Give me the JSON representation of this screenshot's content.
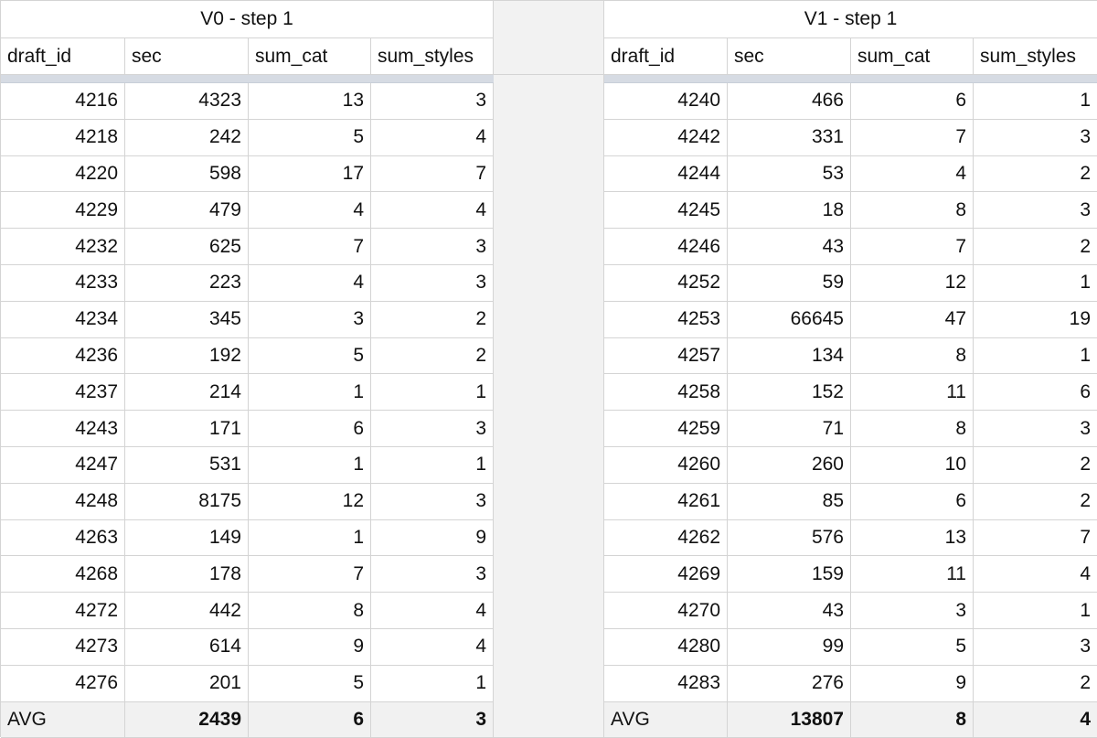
{
  "v0": {
    "title": "V0 - step 1",
    "headers": [
      "draft_id",
      "sec",
      "sum_cat",
      "sum_styles"
    ],
    "rows": [
      [
        "4216",
        "4323",
        "13",
        "3"
      ],
      [
        "4218",
        "242",
        "5",
        "4"
      ],
      [
        "4220",
        "598",
        "17",
        "7"
      ],
      [
        "4229",
        "479",
        "4",
        "4"
      ],
      [
        "4232",
        "625",
        "7",
        "3"
      ],
      [
        "4233",
        "223",
        "4",
        "3"
      ],
      [
        "4234",
        "345",
        "3",
        "2"
      ],
      [
        "4236",
        "192",
        "5",
        "2"
      ],
      [
        "4237",
        "214",
        "1",
        "1"
      ],
      [
        "4243",
        "171",
        "6",
        "3"
      ],
      [
        "4247",
        "531",
        "1",
        "1"
      ],
      [
        "4248",
        "8175",
        "12",
        "3"
      ],
      [
        "4263",
        "149",
        "1",
        "9"
      ],
      [
        "4268",
        "178",
        "7",
        "3"
      ],
      [
        "4272",
        "442",
        "8",
        "4"
      ],
      [
        "4273",
        "614",
        "9",
        "4"
      ],
      [
        "4276",
        "201",
        "5",
        "1"
      ]
    ],
    "avg": [
      "AVG",
      "2439",
      "6",
      "3"
    ]
  },
  "v1": {
    "title": "V1 - step 1",
    "headers": [
      "draft_id",
      "sec",
      "sum_cat",
      "sum_styles"
    ],
    "rows": [
      [
        "4240",
        "466",
        "6",
        "1"
      ],
      [
        "4242",
        "331",
        "7",
        "3"
      ],
      [
        "4244",
        "53",
        "4",
        "2"
      ],
      [
        "4245",
        "18",
        "8",
        "3"
      ],
      [
        "4246",
        "43",
        "7",
        "2"
      ],
      [
        "4252",
        "59",
        "12",
        "1"
      ],
      [
        "4253",
        "66645",
        "47",
        "19"
      ],
      [
        "4257",
        "134",
        "8",
        "1"
      ],
      [
        "4258",
        "152",
        "11",
        "6"
      ],
      [
        "4259",
        "71",
        "8",
        "3"
      ],
      [
        "4260",
        "260",
        "10",
        "2"
      ],
      [
        "4261",
        "85",
        "6",
        "2"
      ],
      [
        "4262",
        "576",
        "13",
        "7"
      ],
      [
        "4269",
        "159",
        "11",
        "4"
      ],
      [
        "4270",
        "43",
        "3",
        "1"
      ],
      [
        "4280",
        "99",
        "5",
        "3"
      ],
      [
        "4283",
        "276",
        "9",
        "2"
      ]
    ],
    "avg": [
      "AVG",
      "13807",
      "8",
      "4"
    ]
  }
}
